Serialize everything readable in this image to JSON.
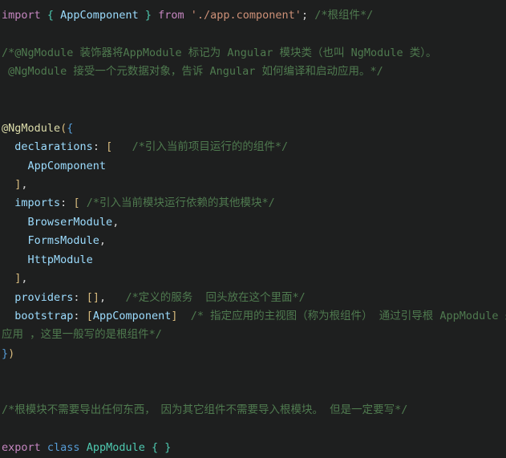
{
  "editor": {
    "language": "typescript",
    "theme": "dark",
    "background": "#1e1f1f",
    "colors": {
      "keyword": "#c586c0",
      "keyword_secondary": "#569cd6",
      "class_name": "#4ec9b0",
      "identifier": "#9cdcfe",
      "string": "#ce9178",
      "comment": "#4f7a4f",
      "decorator": "#dcdcaa",
      "punctuation": "#d4d4d4",
      "bracket_gold": "#d7ba7d",
      "bracket_blue": "#569cd6",
      "bracket_teal": "#4ec9b0"
    }
  },
  "code": {
    "line1": {
      "kw_import": "import",
      "brace_open": " { ",
      "app_component": "AppComponent",
      "brace_close": " } ",
      "kw_from": "from",
      "space": " ",
      "module_path": "'./app.component'",
      "semicolon": ";",
      "comment": " /*根组件*/"
    },
    "line2": "",
    "line3": "/*@NgModule 装饰器将AppModule 标记为 Angular 模块类（也叫 NgModule 类）。",
    "line4": " @NgModule 接受一个元数据对象，告诉 Angular 如何编译和启动应用。*/",
    "line5": "",
    "line6": "",
    "line7": {
      "decorator": "@NgModule",
      "paren": "(",
      "brace": "{"
    },
    "line8": {
      "indent": "  ",
      "prop": "declarations",
      "colon": ": ",
      "bracket": "[",
      "comment": "   /*引入当前项目运行的的组件*/"
    },
    "line9": {
      "indent": "    ",
      "value": "AppComponent"
    },
    "line10": {
      "indent": "  ",
      "bracket": "]",
      "comma": ","
    },
    "line11": {
      "indent": "  ",
      "prop": "imports",
      "colon": ": ",
      "bracket": "[",
      "comment": " /*引入当前模块运行依赖的其他模块*/"
    },
    "line12": {
      "indent": "    ",
      "value": "BrowserModule",
      "comma": ","
    },
    "line13": {
      "indent": "    ",
      "value": "FormsModule",
      "comma": ","
    },
    "line14": {
      "indent": "    ",
      "value": "HttpModule"
    },
    "line15": {
      "indent": "  ",
      "bracket": "]",
      "comma": ","
    },
    "line16": {
      "indent": "  ",
      "prop": "providers",
      "colon": ": ",
      "brackets": "[]",
      "comma": ",",
      "comment": "   /*定义的服务  回头放在这个里面*/"
    },
    "line17": {
      "indent": "  ",
      "prop": "bootstrap",
      "colon": ": ",
      "bracket_open": "[",
      "value": "AppComponent",
      "bracket_close": "]",
      "comment": "  /* 指定应用的主视图（称为根组件） 通过引导根 AppModule 来启动"
    },
    "line18": "应用 ，这里一般写的是根组件*/",
    "line19": {
      "brace": "}",
      "paren": ")"
    },
    "line20": "",
    "line21": "",
    "line22": "/*根模块不需要导出任何东西，　因为其它组件不需要导入根模块。 但是一定要写*/",
    "line23": "",
    "line24": {
      "kw_export": "export",
      "space1": " ",
      "kw_class": "class",
      "space2": " ",
      "class_name": "AppModule",
      "space3": " ",
      "brace_open": "{",
      "inner": " ",
      "brace_close": "}"
    }
  }
}
